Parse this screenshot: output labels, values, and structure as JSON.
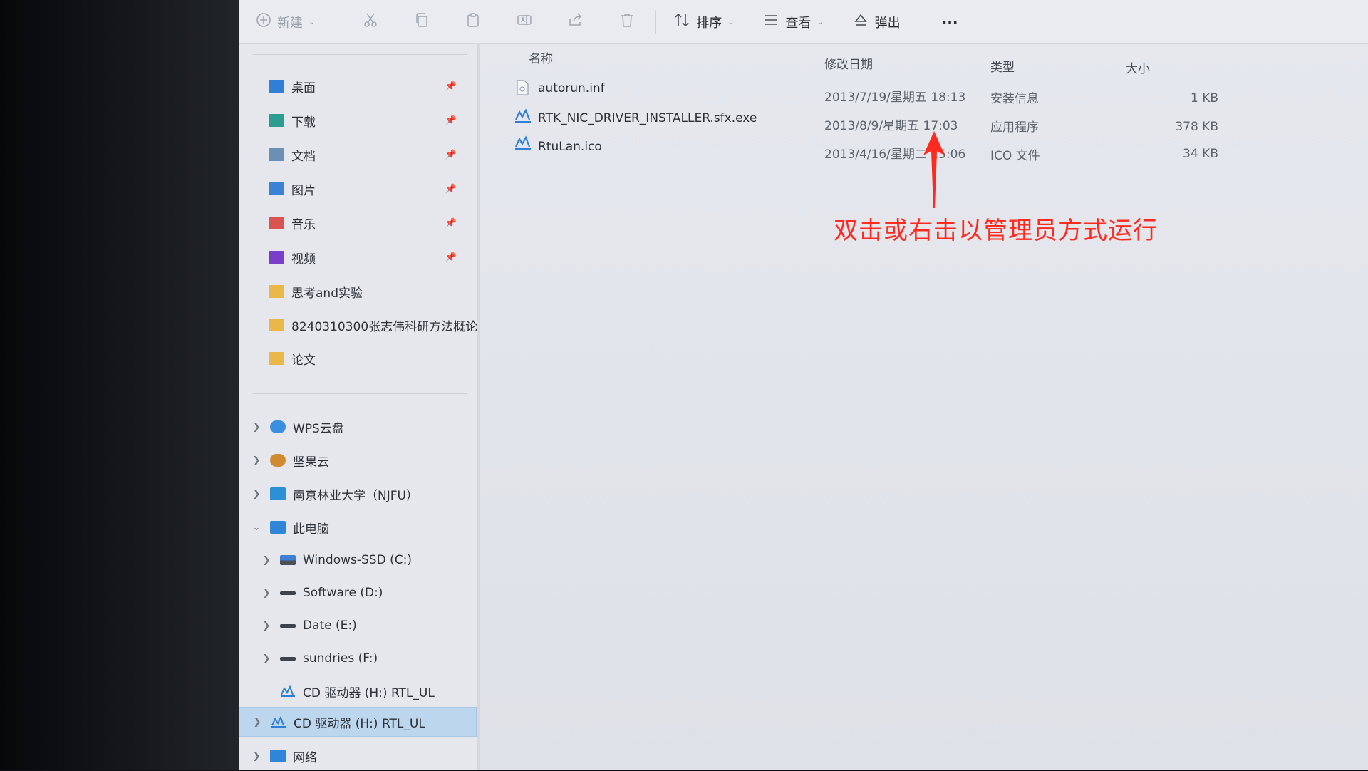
{
  "toolbar": {
    "new_label": "新建",
    "sort_label": "排序",
    "view_label": "查看",
    "eject_label": "弹出",
    "more_label": "···"
  },
  "sidebar": {
    "quick_access": [
      {
        "label": "桌面",
        "icon": "desktop-folder-icon",
        "color": "#2f7fd6",
        "pinned": true
      },
      {
        "label": "下载",
        "icon": "downloads-folder-icon",
        "color": "#2a9d8f",
        "pinned": true
      },
      {
        "label": "文档",
        "icon": "documents-folder-icon",
        "color": "#6c8fb5",
        "pinned": true
      },
      {
        "label": "图片",
        "icon": "pictures-folder-icon",
        "color": "#3b82d6",
        "pinned": true
      },
      {
        "label": "音乐",
        "icon": "music-folder-icon",
        "color": "#d9534f",
        "pinned": true
      },
      {
        "label": "视频",
        "icon": "videos-folder-icon",
        "color": "#7a3fc9",
        "pinned": true
      },
      {
        "label": "思考and实验",
        "icon": "folder-icon",
        "color": "#e8b84a",
        "pinned": false
      },
      {
        "label": "8240310300张志伟科研方法概论",
        "icon": "folder-icon",
        "color": "#e8b84a",
        "pinned": false
      },
      {
        "label": "论文",
        "icon": "folder-icon",
        "color": "#e8b84a",
        "pinned": false
      }
    ],
    "locations": [
      {
        "label": "WPS云盘",
        "icon": "cloud-icon",
        "color": "#3b8fe0",
        "expand": "collapsed"
      },
      {
        "label": "坚果云",
        "icon": "nut-cloud-icon",
        "color": "#d08a2f",
        "expand": "collapsed"
      },
      {
        "label": "南京林业大学（NJFU）",
        "icon": "onedrive-icon",
        "color": "#2d8fd6",
        "expand": "collapsed"
      },
      {
        "label": "此电脑",
        "icon": "computer-icon",
        "color": "#2f86d8",
        "expand": "expanded"
      }
    ],
    "drives": [
      {
        "label": "Windows-SSD (C:)",
        "icon": "system-drive-icon"
      },
      {
        "label": "Software (D:)",
        "icon": "drive-icon"
      },
      {
        "label": "Date (E:)",
        "icon": "drive-icon"
      },
      {
        "label": "sundries (F:)",
        "icon": "drive-icon"
      },
      {
        "label": "CD 驱动器 (H:) RTL_UL",
        "icon": "cd-drive-icon"
      }
    ],
    "selected": {
      "label": "CD 驱动器 (H:) RTL_UL",
      "icon": "cd-drive-icon"
    },
    "network": {
      "label": "网络",
      "icon": "network-icon"
    }
  },
  "columns": {
    "name": "名称",
    "modified": "修改日期",
    "type": "类型",
    "size": "大小"
  },
  "files": [
    {
      "name": "autorun.inf",
      "modified": "2013/7/19/星期五 18:13",
      "type": "安装信息",
      "size": "1 KB",
      "icon": "settings-file-icon"
    },
    {
      "name": "RTK_NIC_DRIVER_INSTALLER.sfx.exe",
      "modified": "2013/8/9/星期五 17:03",
      "type": "应用程序",
      "size": "378 KB",
      "icon": "network-driver-icon"
    },
    {
      "name": "RtuLan.ico",
      "modified": "2013/4/16/星期二 15:06",
      "type": "ICO 文件",
      "size": "34 KB",
      "icon": "network-driver-icon"
    }
  ],
  "annotation": {
    "text": "双击或右击以管理员方式运行",
    "color": "#ff2a1f"
  }
}
